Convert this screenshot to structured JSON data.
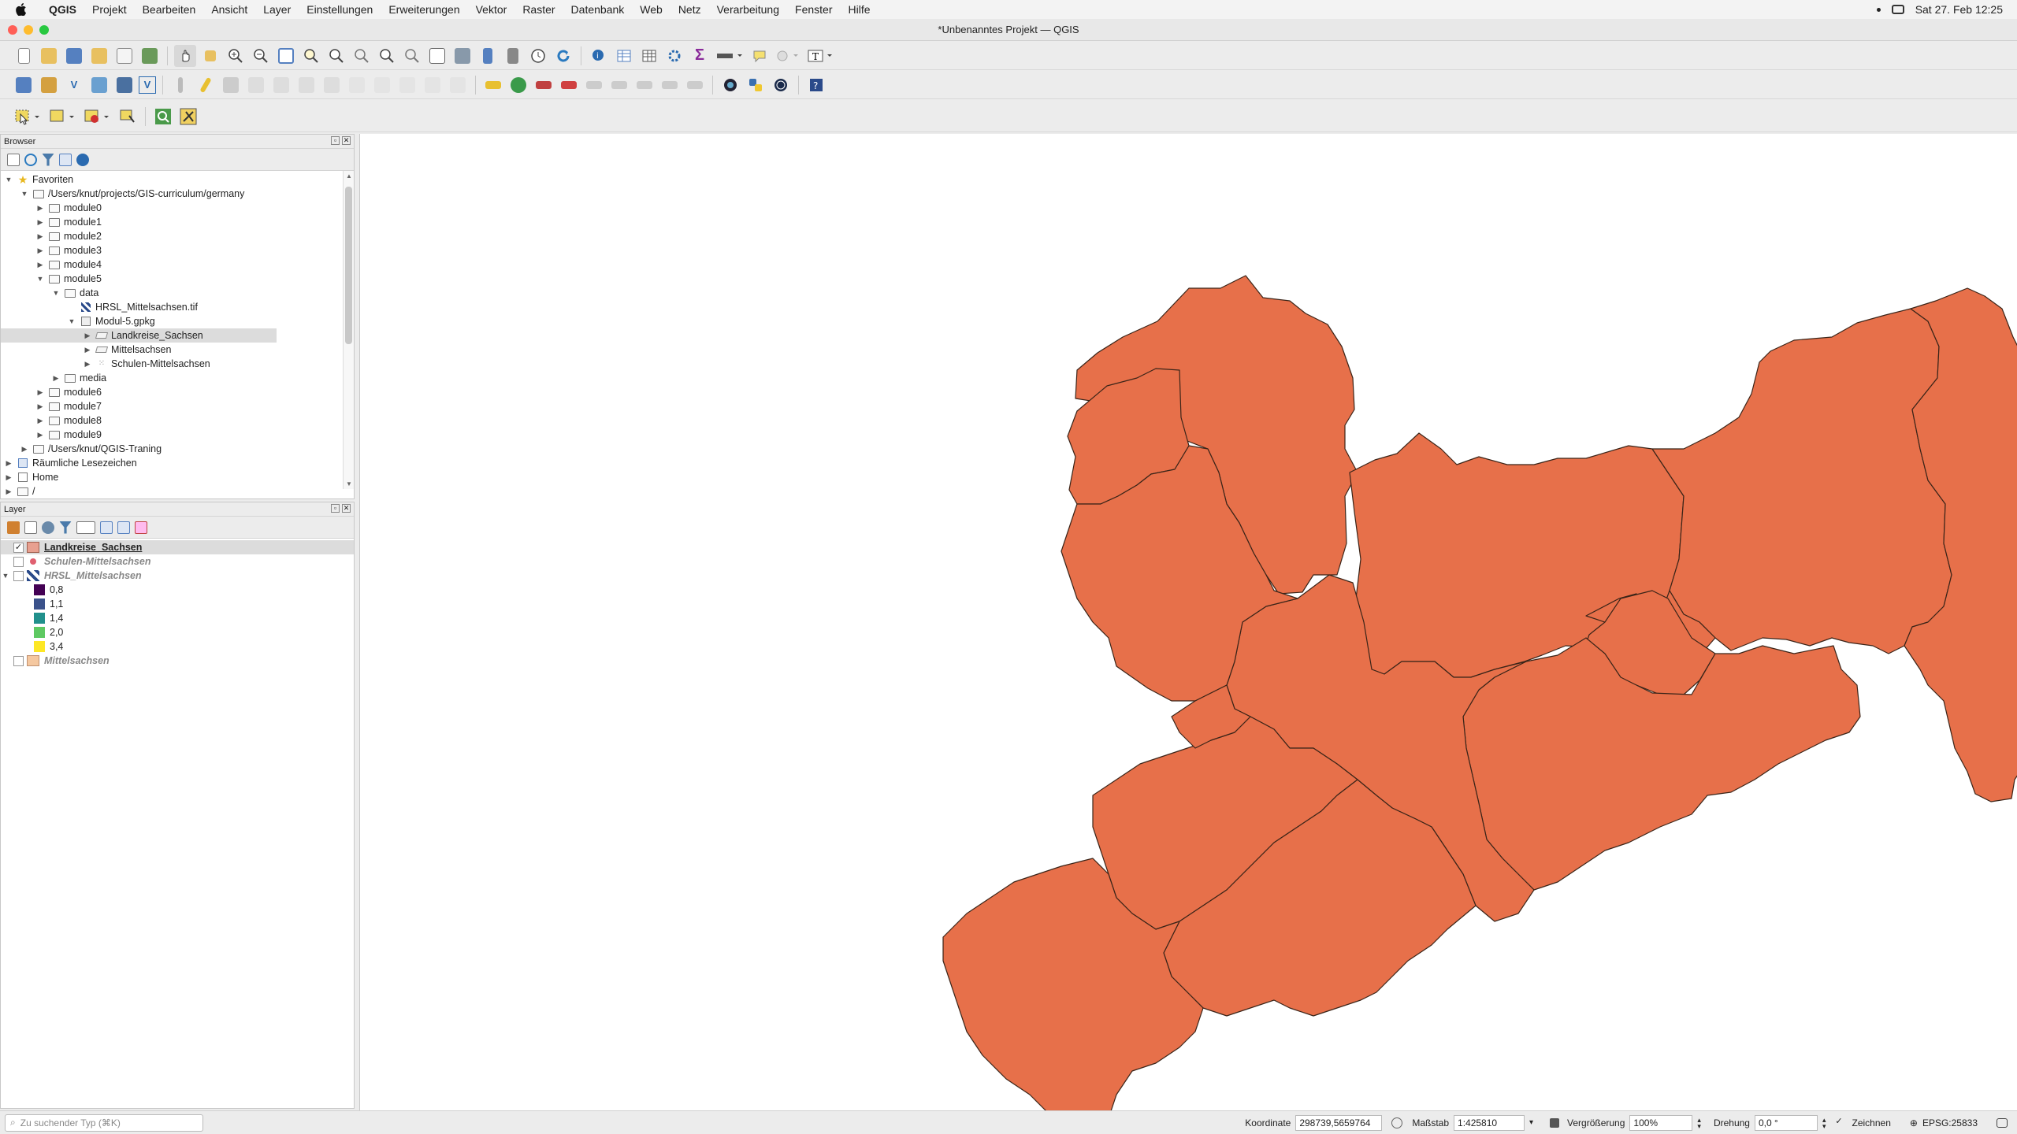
{
  "menubar": {
    "app": "QGIS",
    "items": [
      "Projekt",
      "Bearbeiten",
      "Ansicht",
      "Layer",
      "Einstellungen",
      "Erweiterungen",
      "Vektor",
      "Raster",
      "Datenbank",
      "Web",
      "Netz",
      "Verarbeitung",
      "Fenster",
      "Hilfe"
    ],
    "datetime": "Sat 27. Feb  12:25"
  },
  "window": {
    "title": "*Unbenanntes Projekt — QGIS"
  },
  "browser": {
    "title": "Browser",
    "tree": [
      {
        "label": "Favoriten",
        "depth": 0,
        "arrow": "down",
        "icon": "star-icon"
      },
      {
        "label": "/Users/knut/projects/GIS-curriculum/germany",
        "depth": 1,
        "arrow": "down",
        "icon": "folder-icon"
      },
      {
        "label": "module0",
        "depth": 2,
        "arrow": "right",
        "icon": "folder-icon"
      },
      {
        "label": "module1",
        "depth": 2,
        "arrow": "right",
        "icon": "folder-icon"
      },
      {
        "label": "module2",
        "depth": 2,
        "arrow": "right",
        "icon": "folder-icon"
      },
      {
        "label": "module3",
        "depth": 2,
        "arrow": "right",
        "icon": "folder-icon"
      },
      {
        "label": "module4",
        "depth": 2,
        "arrow": "right",
        "icon": "folder-icon"
      },
      {
        "label": "module5",
        "depth": 2,
        "arrow": "down",
        "icon": "folder-icon"
      },
      {
        "label": "data",
        "depth": 3,
        "arrow": "down",
        "icon": "folder-icon"
      },
      {
        "label": "HRSL_Mittelsachsen.tif",
        "depth": 4,
        "arrow": "",
        "icon": "raster-icon"
      },
      {
        "label": "Modul-5.gpkg",
        "depth": 4,
        "arrow": "down",
        "icon": "geopackage-icon"
      },
      {
        "label": "Landkreise_Sachsen",
        "depth": 5,
        "arrow": "right",
        "icon": "polygon-layer-icon",
        "selected": true
      },
      {
        "label": "Mittelsachsen",
        "depth": 5,
        "arrow": "right",
        "icon": "polygon-layer-icon"
      },
      {
        "label": "Schulen-Mittelsachsen",
        "depth": 5,
        "arrow": "right",
        "icon": "point-layer-icon"
      },
      {
        "label": "media",
        "depth": 3,
        "arrow": "right",
        "icon": "folder-icon"
      },
      {
        "label": "module6",
        "depth": 2,
        "arrow": "right",
        "icon": "folder-icon"
      },
      {
        "label": "module7",
        "depth": 2,
        "arrow": "right",
        "icon": "folder-icon"
      },
      {
        "label": "module8",
        "depth": 2,
        "arrow": "right",
        "icon": "folder-icon"
      },
      {
        "label": "module9",
        "depth": 2,
        "arrow": "right",
        "icon": "folder-icon"
      },
      {
        "label": "/Users/knut/QGIS-Traning",
        "depth": 1,
        "arrow": "right",
        "icon": "folder-icon"
      },
      {
        "label": "Räumliche Lesezeichen",
        "depth": 0,
        "arrow": "right",
        "icon": "bookmark-icon"
      },
      {
        "label": "Home",
        "depth": 0,
        "arrow": "right",
        "icon": "home-icon"
      },
      {
        "label": "/",
        "depth": 0,
        "arrow": "right",
        "icon": "folder-icon"
      }
    ]
  },
  "layers": {
    "title": "Layer",
    "items": [
      {
        "label": "Landkreise_Sachsen",
        "checked": true,
        "color": "#e8a090",
        "style": "bold"
      },
      {
        "label": "Schulen-Mittelsachsen",
        "checked": false,
        "color": "#e06070",
        "style": "italic"
      },
      {
        "label": "HRSL_Mittelsachsen",
        "checked": false,
        "color": "#335",
        "style": "italic",
        "expanded": true
      }
    ],
    "legend": [
      {
        "label": "0,8",
        "color": "#440154"
      },
      {
        "label": "1,1",
        "color": "#3b528b"
      },
      {
        "label": "1,4",
        "color": "#21908c"
      },
      {
        "label": "2,0",
        "color": "#5ec962"
      },
      {
        "label": "3,4",
        "color": "#fde725"
      }
    ],
    "last": {
      "label": "Mittelsachsen",
      "checked": false,
      "color": "#f5c8a0",
      "style": "italic"
    }
  },
  "map": {
    "fill": "#e7704a",
    "stroke": "#3a2418"
  },
  "status": {
    "search_placeholder": "Zu suchender Typ (⌘K)",
    "coord_label": "Koordinate",
    "coord_value": "298739,5659764",
    "scale_label": "Maßstab",
    "scale_value": "1:425810",
    "magnifier_label": "Vergrößerung",
    "magnifier_value": "100%",
    "rotation_label": "Drehung",
    "rotation_value": "0,0 °",
    "render_label": "Zeichnen",
    "crs": "EPSG:25833"
  }
}
